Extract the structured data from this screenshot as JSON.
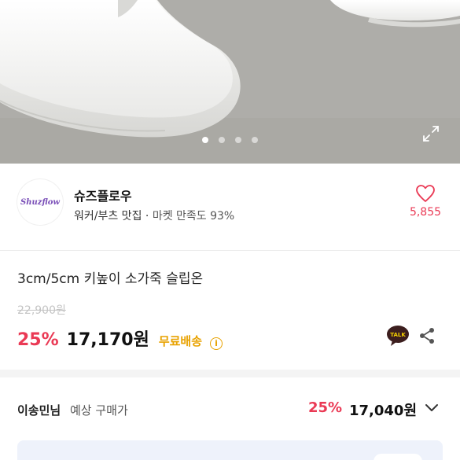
{
  "carousel": {
    "slides": 4,
    "active_index": 0
  },
  "store": {
    "logo_text": "Shuzflow",
    "name": "슈즈플로우",
    "category": "워커/부츠 맛집",
    "separator": "·",
    "satisfaction_label": "마켓 만족도 93%",
    "likes": "5,855"
  },
  "product": {
    "name": "3cm/5cm 키높이 소가죽 슬립온",
    "original_price": "22,900원",
    "discount": "25%",
    "price": "17,170원",
    "shipping": "무료배송",
    "info_glyph": "i",
    "talk_label": "TALK"
  },
  "member": {
    "name": "이송민님",
    "label": "예상 구매가",
    "discount": "25%",
    "price": "17,040원"
  },
  "colors": {
    "accent": "#ea3a55",
    "shipping": "#e8a200",
    "kakao": "#3c1e1e",
    "divider": "#ececec"
  },
  "icons": {
    "expand": "expand-icon",
    "heart": "heart-icon",
    "talk": "kakao-talk-icon",
    "share": "share-icon",
    "chevron": "chevron-down-icon"
  }
}
